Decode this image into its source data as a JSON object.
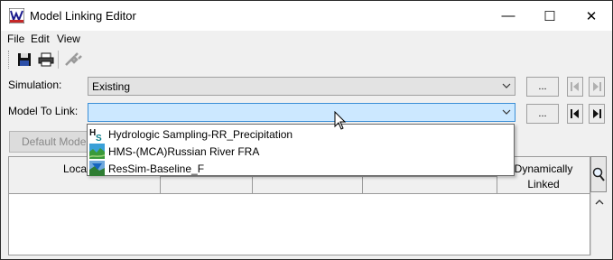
{
  "window": {
    "title": "Model Linking Editor",
    "minimize": "—",
    "maximize": "☐",
    "close": "✕"
  },
  "menu": {
    "items": [
      "File",
      "Edit",
      "View"
    ]
  },
  "toolbar": {
    "save_icon": "floppy-disk-icon",
    "print_icon": "printer-icon",
    "link_icon": "link-plug-icon"
  },
  "simulation": {
    "label": "Simulation:",
    "value": "Existing",
    "browse": "..."
  },
  "model_to_link": {
    "label": "Model To Link:",
    "value": "",
    "browse": "..."
  },
  "dropdown": {
    "items": [
      {
        "label": "Hydrologic Sampling-RR_Precipitation",
        "icon": "hs-model-icon"
      },
      {
        "label": "HMS-(MCA)Russian River FRA",
        "icon": "hms-model-icon"
      },
      {
        "label": "ResSim-Baseline_F",
        "icon": "ressim-model-icon"
      }
    ]
  },
  "default_button": {
    "label": "Default Mode"
  },
  "table": {
    "col_location": "Loca",
    "col_dynamic": "Dynamically\nLinked"
  },
  "colors": {
    "selected_bg": "#cce8ff",
    "window_bg": "#f0f0f0"
  }
}
